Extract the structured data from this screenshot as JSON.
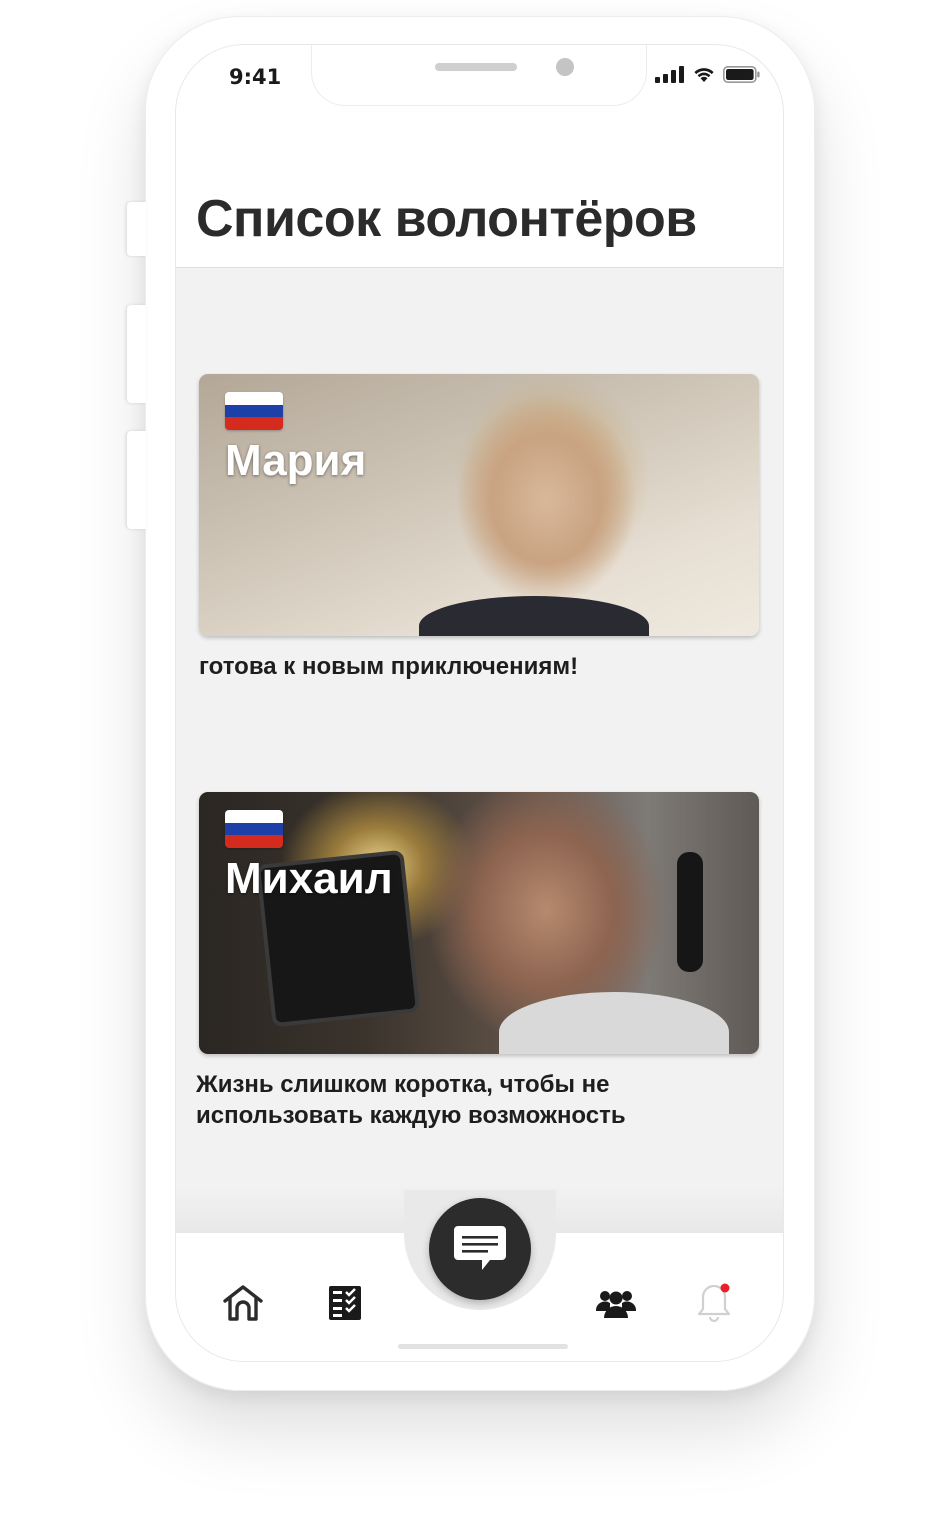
{
  "status_bar": {
    "time": "9:41",
    "signal_icon": "cellular-signal-icon",
    "wifi_icon": "wifi-icon",
    "battery_icon": "battery-icon"
  },
  "header": {
    "title": "Список волонтёров"
  },
  "volunteers": [
    {
      "name": "Мария",
      "flag": "russia-flag-icon",
      "caption": "готова к новым приключениям!"
    },
    {
      "name": "Михаил",
      "flag": "russia-flag-icon",
      "caption": "Жизнь слишком коротка, чтобы не использовать каждую возможность"
    }
  ],
  "tabbar": {
    "items": [
      {
        "icon": "home-icon"
      },
      {
        "icon": "checklist-icon"
      },
      {
        "icon": "chat-icon"
      },
      {
        "icon": "group-icon"
      },
      {
        "icon": "bell-icon"
      }
    ],
    "notification_dot_color": "#e8202a"
  },
  "colors": {
    "accent_dark": "#2c2c2c",
    "background": "#f2f2f2",
    "flag_white": "#ffffff",
    "flag_blue": "#1c3fa8",
    "flag_red": "#d52b1e"
  }
}
